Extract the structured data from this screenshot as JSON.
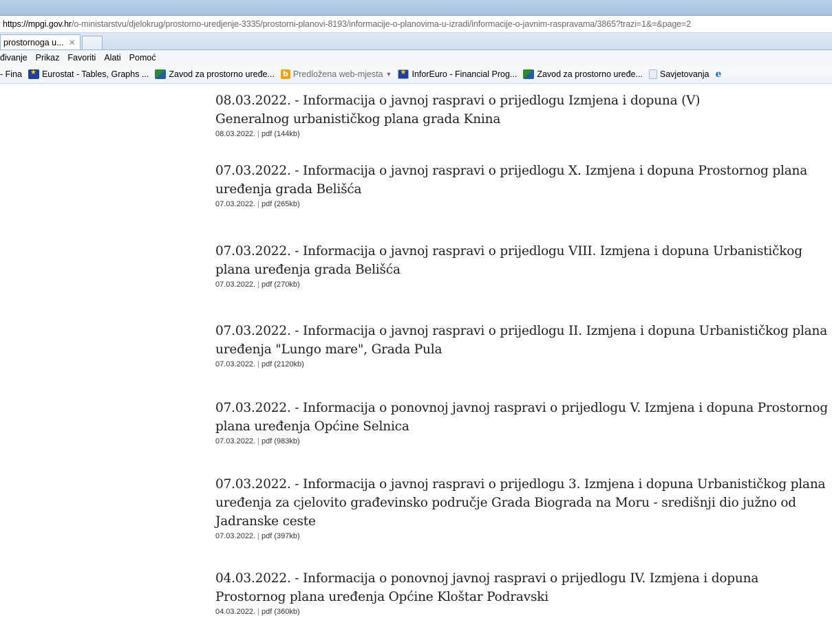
{
  "browser": {
    "address": {
      "host": "https://mpgi.gov.hr",
      "path": "/o-ministarstvu/djelokrug/prostorno-uredjenje-3335/prostorni-planovi-8193/informacije-o-planovima-u-izradi/informacije-o-javnim-raspravama/3865?trazi=1&=&page=2"
    },
    "tab": {
      "label": "prostornoga u...",
      "close_glyph": "✕"
    },
    "menu": [
      "đivanje",
      "Prikaz",
      "Favoriti",
      "Alati",
      "Pomoć"
    ],
    "favorites": [
      {
        "label": "- Fina",
        "icon": "none"
      },
      {
        "label": "Eurostat - Tables, Graphs ...",
        "icon": "eu-flag-icon"
      },
      {
        "label": "Zavod za prostorno uređe...",
        "icon": "zavod-icon"
      },
      {
        "label": "Predložena web-mjesta",
        "icon": "bing-icon",
        "dropdown": "▼"
      },
      {
        "label": "InforEuro - Financial Prog...",
        "icon": "eu-flag-icon"
      },
      {
        "label": "Zavod za prostorno uređe...",
        "icon": "zavod-icon"
      },
      {
        "label": "Savjetovanja",
        "icon": "document-icon"
      },
      {
        "label": "",
        "icon": "ie-icon",
        "glyph": "e"
      }
    ]
  },
  "entries": [
    {
      "title_line1": "08.03.2022. - Informacija o javnoj raspravi o prijedlogu Izmjena i dopuna (V)",
      "title_line2": "Generalnog urbanističkog plana grada Knina",
      "date": "08.03.2022.",
      "file": "pdf (144kb)"
    },
    {
      "title": "07.03.2022. - Informacija o javnoj raspravi o prijedlogu X. Izmjena i dopuna Prostornog plana uređenja grada Belišća",
      "date": "07.03.2022.",
      "file": "pdf (265kb)"
    },
    {
      "title": "07.03.2022. - Informacija o javnoj raspravi o prijedlogu VIII. Izmjena i dopuna Urbanističkog plana uređenja grada Belišća",
      "date": "07.03.2022.",
      "file": "pdf (270kb)"
    },
    {
      "title": "07.03.2022. - Informacija o javnoj raspravi o prijedlogu II. Izmjena i dopuna Urbanističkog plana uređenja \"Lungo mare\", Grada Pula",
      "date": "07.03.2022.",
      "file": "pdf (2120kb)"
    },
    {
      "title": "07.03.2022. - Informacija o ponovnoj javnoj raspravi o prijedlogu V. Izmjena i dopuna Prostornog plana uređenja Općine Selnica",
      "date": "07.03.2022.",
      "file": "pdf (983kb)"
    },
    {
      "title": "07.03.2022. - Informacija o javnoj raspravi o prijedlogu 3. Izmjena i dopuna Urbanističkog plana uređenja za cjelovito građevinsko područje Grada Biograda na Moru - središnji dio južno od Jadranske ceste",
      "date": "07.03.2022.",
      "file": "pdf (397kb)"
    },
    {
      "title": "04.03.2022. - Informacija o ponovnoj javnoj raspravi o prijedlogu IV. Izmjena i dopuna Prostornog plana uređenja Općine Kloštar Podravski",
      "date": "04.03.2022.",
      "file": "pdf (360kb)"
    }
  ]
}
